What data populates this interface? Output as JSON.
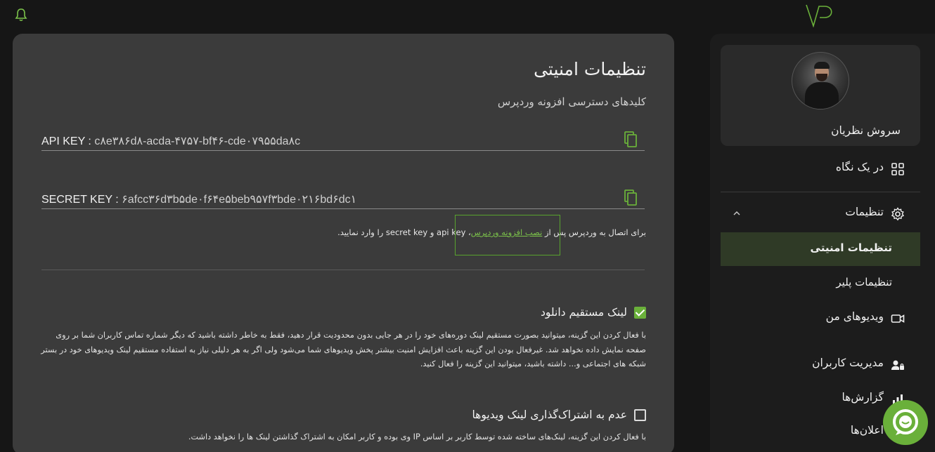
{
  "header": {
    "bell_icon": "bell-icon",
    "logo_icon": "vp-logo"
  },
  "main": {
    "title": "تنظیمات امنیتی",
    "subtitle": "کلیدهای دسترسی افزونه وردپرس",
    "api_key": {
      "label": "API KEY :",
      "value": "c۸e۳۸۶d۸-acda-۴۷۵۷-bf۴۶-cde۰۷۹۵۵da۸c",
      "copy_icon": "copy-icon"
    },
    "secret_key": {
      "label": "SECRET KEY :",
      "value": "۶afcc۳۶d۳b۵de۰f۶۴e۵beb۹۵۷f۳bde۰۲۱۶bd۶dc۱",
      "copy_icon": "copy-icon"
    },
    "note": {
      "before": "برای اتصال به وردپرس پس از ",
      "link": "نصب افزونه وردپرس",
      "after": "، api key و secret key را وارد نمایید."
    },
    "options": [
      {
        "title": "لینک مستقیم دانلود",
        "checked": true,
        "description": "با فعال کردن این گزینه، میتوانید بصورت مستقیم لینک دوره‌های خود را در هر جایی بدون محدودیت قرار دهید، فقط به خاطر داشته باشید که دیگر شماره تماس کاربران شما بر روی صفحه نمایش داده نخواهد شد. غیرفعال بودن این گزینه باعث افزایش امنیت بیشتر پخش ویدیوهای شما می‌شود ولی اگر به هر دلیلی نیاز به استفاده مستقیم لینک ویدیوهای خود در بستر شبکه های اجتماعی و... داشته باشید، میتوانید این گزینه را فعال کنید."
      },
      {
        "title": "عدم به اشتراک‌گذاری لینک ویدیوها",
        "checked": false,
        "description": "با فعال کردن این گزینه، لینک‌های ساخته شده توسط کاربر بر اساس IP وی بوده و کاربر امکان به اشتراک گذاشتن لینک ها را نخواهد داشت."
      }
    ]
  },
  "sidebar": {
    "user_name": "سروش نظریان",
    "items": {
      "overview": {
        "label": "در یک نگاه",
        "icon": "grid-icon"
      },
      "settings": {
        "label": "تنظیمات",
        "icon": "gear-icon"
      },
      "security": {
        "label": "تنظیمات امنیتی"
      },
      "player": {
        "label": "تنظیمات پلیر"
      },
      "videos": {
        "label": "ویدیوهای من",
        "icon": "video-icon"
      },
      "users": {
        "label": "مدیریت کاربران",
        "icon": "users-icon"
      },
      "reports": {
        "label": "گزارش‌ها",
        "icon": "chart-icon"
      },
      "notifications": {
        "label": "اعلان‌ها"
      }
    }
  },
  "colors": {
    "accent": "#6ab03a",
    "card": "#3b3b3b",
    "background": "#161616"
  }
}
